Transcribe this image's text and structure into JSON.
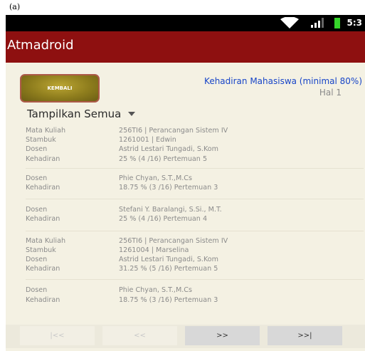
{
  "figure_label": "(a)",
  "status_bar": {
    "time": "5:3"
  },
  "app_bar": {
    "title": "Atmadroid"
  },
  "header": {
    "back_label": "KEMBALI",
    "title": "Kehadiran Mahasiswa (minimal 80%)",
    "page": "Hal 1"
  },
  "filter": {
    "label": "Tampilkan Semua"
  },
  "records": [
    {
      "rows": [
        {
          "label": "Mata Kuliah",
          "value": "256TI6 | Perancangan Sistem IV"
        },
        {
          "label": "Stambuk",
          "value": "1261001 | Edwin"
        },
        {
          "label": "Dosen",
          "value": "Astrid Lestari Tungadi, S.Kom"
        },
        {
          "label": "Kehadiran",
          "value": "25 % (4 /16) Pertemuan 5"
        }
      ]
    },
    {
      "rows": [
        {
          "label": "Dosen",
          "value": "Phie Chyan, S.T.,M.Cs"
        },
        {
          "label": "Kehadiran",
          "value": "18.75 % (3 /16) Pertemuan 3"
        }
      ]
    },
    {
      "rows": [
        {
          "label": "Dosen",
          "value": "Stefani Y. Baralangi, S.Si., M.T."
        },
        {
          "label": "Kehadiran",
          "value": "25 % (4 /16) Pertemuan 4"
        }
      ]
    },
    {
      "rows": [
        {
          "label": "Mata Kuliah",
          "value": "256TI6 | Perancangan Sistem IV"
        },
        {
          "label": "Stambuk",
          "value": "1261004 | Marselina"
        },
        {
          "label": "Dosen",
          "value": "Astrid Lestari Tungadi, S.Kom"
        },
        {
          "label": "Kehadiran",
          "value": "31.25 % (5 /16) Pertemuan 5"
        }
      ]
    },
    {
      "rows": [
        {
          "label": "Dosen",
          "value": "Phie Chyan, S.T.,M.Cs"
        },
        {
          "label": "Kehadiran",
          "value": "18.75 % (3 /16) Pertemuan 3"
        }
      ]
    }
  ],
  "pager": {
    "first": "|<<",
    "prev": "<<",
    "next": ">>",
    "last": ">>|"
  },
  "colors": {
    "appbar": "#8e1010",
    "title_link": "#1745c8",
    "background": "#f4f1e3",
    "button": "#8e7d1d"
  }
}
